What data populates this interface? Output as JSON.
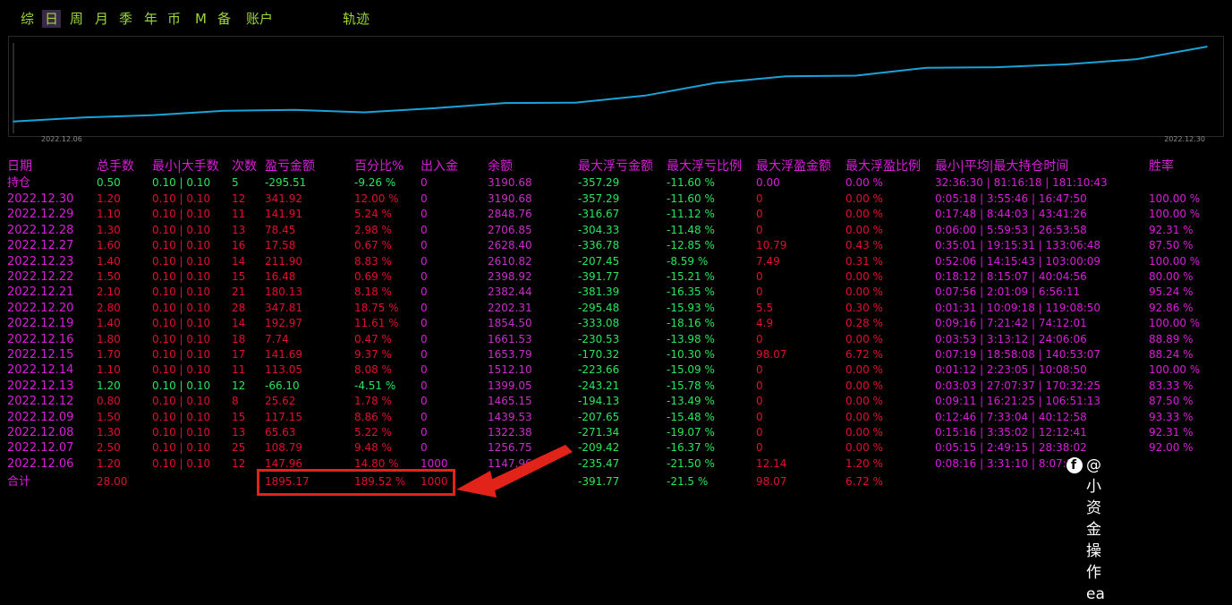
{
  "tabs": [
    "综",
    "日",
    "周",
    "月",
    "季",
    "年",
    "币",
    "M",
    "备",
    "账户",
    "轨迹"
  ],
  "active_tab": "日",
  "equity_chart": {
    "start_label": "2022.12.06",
    "end_label": "2022.12.30",
    "dates": [
      "2022.12.06",
      "2022.12.07",
      "2022.12.08",
      "2022.12.09",
      "2022.12.12",
      "2022.12.13",
      "2022.12.14",
      "2022.12.15",
      "2022.12.16",
      "2022.12.19",
      "2022.12.20",
      "2022.12.21",
      "2022.12.22",
      "2022.12.23",
      "2022.12.27",
      "2022.12.28",
      "2022.12.29",
      "2022.12.30"
    ],
    "values": [
      1147.96,
      1256.75,
      1322.38,
      1439.53,
      1465.15,
      1399.05,
      1512.1,
      1653.79,
      1661.53,
      1854.5,
      2202.31,
      2382.44,
      2398.92,
      2610.82,
      2628.4,
      2706.85,
      2848.76,
      3190.68
    ],
    "line_color": "#1aa3d9"
  },
  "columns": [
    "日期",
    "总手数",
    "最小|大手数",
    "次数",
    "盈亏金额",
    "百分比%",
    "出入金",
    "余额",
    "最大浮亏金额",
    "最大浮亏比例",
    "最大浮盈金额",
    "最大浮盈比例",
    "最小|平均|最大持仓时间",
    "胜率"
  ],
  "holding": {
    "date": "持仓",
    "lots": "0.50",
    "minmax": "0.10 | 0.10",
    "count": "5",
    "pnl": "-295.51",
    "pct": "-9.26 %",
    "flow": "0",
    "balance": "3190.68",
    "max_loss": "-357.29",
    "max_loss_pct": "-11.60 %",
    "max_profit": "0.00",
    "max_profit_pct": "0.00 %",
    "hold_time": "32:36:30 | 81:16:18 | 181:10:43",
    "win": ""
  },
  "rows": [
    {
      "date": "2022.12.30",
      "lots": "1.20",
      "minmax": "0.10 | 0.10",
      "count": "12",
      "pnl": "341.92",
      "pct": "12.00 %",
      "flow": "0",
      "balance": "3190.68",
      "max_loss": "-357.29",
      "max_loss_pct": "-11.60 %",
      "max_profit": "0",
      "max_profit_pct": "0.00 %",
      "hold_time": "0:05:18 | 3:55:46 | 16:47:50",
      "win": "100.00 %"
    },
    {
      "date": "2022.12.29",
      "lots": "1.10",
      "minmax": "0.10 | 0.10",
      "count": "11",
      "pnl": "141.91",
      "pct": "5.24 %",
      "flow": "0",
      "balance": "2848.76",
      "max_loss": "-316.67",
      "max_loss_pct": "-11.12 %",
      "max_profit": "0",
      "max_profit_pct": "0.00 %",
      "hold_time": "0:17:48 | 8:44:03 | 43:41:26",
      "win": "100.00 %"
    },
    {
      "date": "2022.12.28",
      "lots": "1.30",
      "minmax": "0.10 | 0.10",
      "count": "13",
      "pnl": "78.45",
      "pct": "2.98 %",
      "flow": "0",
      "balance": "2706.85",
      "max_loss": "-304.33",
      "max_loss_pct": "-11.48 %",
      "max_profit": "0",
      "max_profit_pct": "0.00 %",
      "hold_time": "0:06:00 | 5:59:53 | 26:53:58",
      "win": "92.31 %"
    },
    {
      "date": "2022.12.27",
      "lots": "1.60",
      "minmax": "0.10 | 0.10",
      "count": "16",
      "pnl": "17.58",
      "pct": "0.67 %",
      "flow": "0",
      "balance": "2628.40",
      "max_loss": "-336.78",
      "max_loss_pct": "-12.85 %",
      "max_profit": "10.79",
      "max_profit_pct": "0.43 %",
      "hold_time": "0:35:01 | 19:15:31 | 133:06:48",
      "win": "87.50 %"
    },
    {
      "date": "2022.12.23",
      "lots": "1.40",
      "minmax": "0.10 | 0.10",
      "count": "14",
      "pnl": "211.90",
      "pct": "8.83 %",
      "flow": "0",
      "balance": "2610.82",
      "max_loss": "-207.45",
      "max_loss_pct": "-8.59 %",
      "max_profit": "7.49",
      "max_profit_pct": "0.31 %",
      "hold_time": "0:52:06 | 14:15:43 | 103:00:09",
      "win": "100.00 %"
    },
    {
      "date": "2022.12.22",
      "lots": "1.50",
      "minmax": "0.10 | 0.10",
      "count": "15",
      "pnl": "16.48",
      "pct": "0.69 %",
      "flow": "0",
      "balance": "2398.92",
      "max_loss": "-391.77",
      "max_loss_pct": "-15.21 %",
      "max_profit": "0",
      "max_profit_pct": "0.00 %",
      "hold_time": "0:18:12 | 8:15:07 | 40:04:56",
      "win": "80.00 %"
    },
    {
      "date": "2022.12.21",
      "lots": "2.10",
      "minmax": "0.10 | 0.10",
      "count": "21",
      "pnl": "180.13",
      "pct": "8.18 %",
      "flow": "0",
      "balance": "2382.44",
      "max_loss": "-381.39",
      "max_loss_pct": "-16.35 %",
      "max_profit": "0",
      "max_profit_pct": "0.00 %",
      "hold_time": "0:07:56 | 2:01:09 | 6:56:11",
      "win": "95.24 %"
    },
    {
      "date": "2022.12.20",
      "lots": "2.80",
      "minmax": "0.10 | 0.10",
      "count": "28",
      "pnl": "347.81",
      "pct": "18.75 %",
      "flow": "0",
      "balance": "2202.31",
      "max_loss": "-295.48",
      "max_loss_pct": "-15.93 %",
      "max_profit": "5.5",
      "max_profit_pct": "0.30 %",
      "hold_time": "0:01:31 | 10:09:18 | 119:08:50",
      "win": "92.86 %"
    },
    {
      "date": "2022.12.19",
      "lots": "1.40",
      "minmax": "0.10 | 0.10",
      "count": "14",
      "pnl": "192.97",
      "pct": "11.61 %",
      "flow": "0",
      "balance": "1854.50",
      "max_loss": "-333.08",
      "max_loss_pct": "-18.16 %",
      "max_profit": "4.9",
      "max_profit_pct": "0.28 %",
      "hold_time": "0:09:16 | 7:21:42 | 74:12:01",
      "win": "100.00 %"
    },
    {
      "date": "2022.12.16",
      "lots": "1.80",
      "minmax": "0.10 | 0.10",
      "count": "18",
      "pnl": "7.74",
      "pct": "0.47 %",
      "flow": "0",
      "balance": "1661.53",
      "max_loss": "-230.53",
      "max_loss_pct": "-13.98 %",
      "max_profit": "0",
      "max_profit_pct": "0.00 %",
      "hold_time": "0:03:53 | 3:13:12 | 24:06:06",
      "win": "88.89 %"
    },
    {
      "date": "2022.12.15",
      "lots": "1.70",
      "minmax": "0.10 | 0.10",
      "count": "17",
      "pnl": "141.69",
      "pct": "9.37 %",
      "flow": "0",
      "balance": "1653.79",
      "max_loss": "-170.32",
      "max_loss_pct": "-10.30 %",
      "max_profit": "98.07",
      "max_profit_pct": "6.72 %",
      "hold_time": "0:07:19 | 18:58:08 | 140:53:07",
      "win": "88.24 %"
    },
    {
      "date": "2022.12.14",
      "lots": "1.10",
      "minmax": "0.10 | 0.10",
      "count": "11",
      "pnl": "113.05",
      "pct": "8.08 %",
      "flow": "0",
      "balance": "1512.10",
      "max_loss": "-223.66",
      "max_loss_pct": "-15.09 %",
      "max_profit": "0",
      "max_profit_pct": "0.00 %",
      "hold_time": "0:01:12 | 2:23:05 | 10:08:50",
      "win": "100.00 %"
    },
    {
      "date": "2022.12.13",
      "lots": "1.20",
      "minmax": "0.10 | 0.10",
      "count": "12",
      "pnl": "-66.10",
      "pct": "-4.51 %",
      "flow": "0",
      "balance": "1399.05",
      "max_loss": "-243.21",
      "max_loss_pct": "-15.78 %",
      "max_profit": "0",
      "max_profit_pct": "0.00 %",
      "hold_time": "0:03:03 | 27:07:37 | 170:32:25",
      "win": "83.33 %"
    },
    {
      "date": "2022.12.12",
      "lots": "0.80",
      "minmax": "0.10 | 0.10",
      "count": "8",
      "pnl": "25.62",
      "pct": "1.78 %",
      "flow": "0",
      "balance": "1465.15",
      "max_loss": "-194.13",
      "max_loss_pct": "-13.49 %",
      "max_profit": "0",
      "max_profit_pct": "0.00 %",
      "hold_time": "0:09:11 | 16:21:25 | 106:51:13",
      "win": "87.50 %"
    },
    {
      "date": "2022.12.09",
      "lots": "1.50",
      "minmax": "0.10 | 0.10",
      "count": "15",
      "pnl": "117.15",
      "pct": "8.86 %",
      "flow": "0",
      "balance": "1439.53",
      "max_loss": "-207.65",
      "max_loss_pct": "-15.48 %",
      "max_profit": "0",
      "max_profit_pct": "0.00 %",
      "hold_time": "0:12:46 | 7:33:04 | 40:12:58",
      "win": "93.33 %"
    },
    {
      "date": "2022.12.08",
      "lots": "1.30",
      "minmax": "0.10 | 0.10",
      "count": "13",
      "pnl": "65.63",
      "pct": "5.22 %",
      "flow": "0",
      "balance": "1322.38",
      "max_loss": "-271.34",
      "max_loss_pct": "-19.07 %",
      "max_profit": "0",
      "max_profit_pct": "0.00 %",
      "hold_time": "0:15:16 | 3:35:02 | 12:12:41",
      "win": "92.31 %"
    },
    {
      "date": "2022.12.07",
      "lots": "2.50",
      "minmax": "0.10 | 0.10",
      "count": "25",
      "pnl": "108.79",
      "pct": "9.48 %",
      "flow": "0",
      "balance": "1256.75",
      "max_loss": "-209.42",
      "max_loss_pct": "-16.37 %",
      "max_profit": "0",
      "max_profit_pct": "0.00 %",
      "hold_time": "0:05:15 | 2:49:15 | 28:38:02",
      "win": "92.00 %"
    },
    {
      "date": "2022.12.06",
      "lots": "1.20",
      "minmax": "0.10 | 0.10",
      "count": "12",
      "pnl": "147.96",
      "pct": "14.80 %",
      "flow": "1000",
      "balance": "1147.96",
      "max_loss": "-235.47",
      "max_loss_pct": "-21.50 %",
      "max_profit": "12.14",
      "max_profit_pct": "1.20 %",
      "hold_time": "0:08:16 | 3:31:10 | 8:07:28",
      "win": ""
    }
  ],
  "total": {
    "label": "合计",
    "lots": "28.00",
    "pnl": "1895.17",
    "pct": "189.52 %",
    "flow": "1000",
    "max_loss": "-391.77",
    "max_loss_pct": "-21.5 %",
    "max_profit": "98.07",
    "max_profit_pct": "6.72 %"
  },
  "watermark": "@小资金操作ea",
  "colors": {
    "header": "#d91ed9",
    "positive": "#e0102e",
    "negative": "#29e65a",
    "balance": "#c82ec8",
    "date": "#d91ed9",
    "loss_col": "#29e65a",
    "win": "#d91ed9",
    "total": "#e0102e",
    "highlight_box": "#e2231a"
  }
}
